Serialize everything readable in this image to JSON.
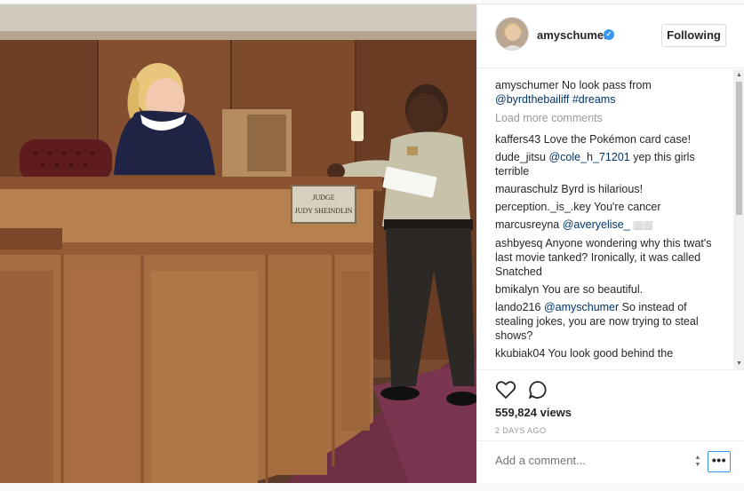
{
  "post": {
    "username": "amyschumer",
    "follow_label": "Following",
    "caption_user": "amyschumer",
    "caption_text": "No look pass from",
    "caption_mention": "@byrdthebailiff",
    "caption_tag": "#dreams",
    "load_more": "Load more comments",
    "views": "559,824 views",
    "date": "2 DAYS AGO",
    "add_comment_placeholder": "Add a comment...",
    "more_label": "•••"
  },
  "media": {
    "nameplate_line1": "JUDGE",
    "nameplate_line2": "JUDY SHEINDLIN"
  },
  "comments": [
    {
      "user": "kaffers43",
      "mention": "",
      "text": "Love the Pokémon card case!"
    },
    {
      "user": "dude_jitsu",
      "mention": "@cole_h_71201",
      "text": "yep this girls terrible"
    },
    {
      "user": "mauraschulz",
      "mention": "",
      "text": "Byrd is hilarious!"
    },
    {
      "user": "perception._is_.key",
      "mention": "",
      "text": "You're cancer"
    },
    {
      "user": "marcusreyna",
      "mention": "@averyelise_",
      "text": "⬜⬜"
    },
    {
      "user": "ashbyesq",
      "mention": "",
      "text": "Anyone wondering why this twat's last movie tanked? Ironically, it was called Snatched"
    },
    {
      "user": "bmikalyn",
      "mention": "",
      "text": "You are so beautiful."
    },
    {
      "user": "lando216",
      "mention": "@amyschumer",
      "text": "So instead of stealing jokes, you are now trying to steal shows?"
    },
    {
      "user": "kkubiak04",
      "mention": "",
      "text": "You look good behind the"
    }
  ],
  "colors": {
    "accent": "#3897f0",
    "mention": "#003569",
    "muted": "#999999"
  }
}
